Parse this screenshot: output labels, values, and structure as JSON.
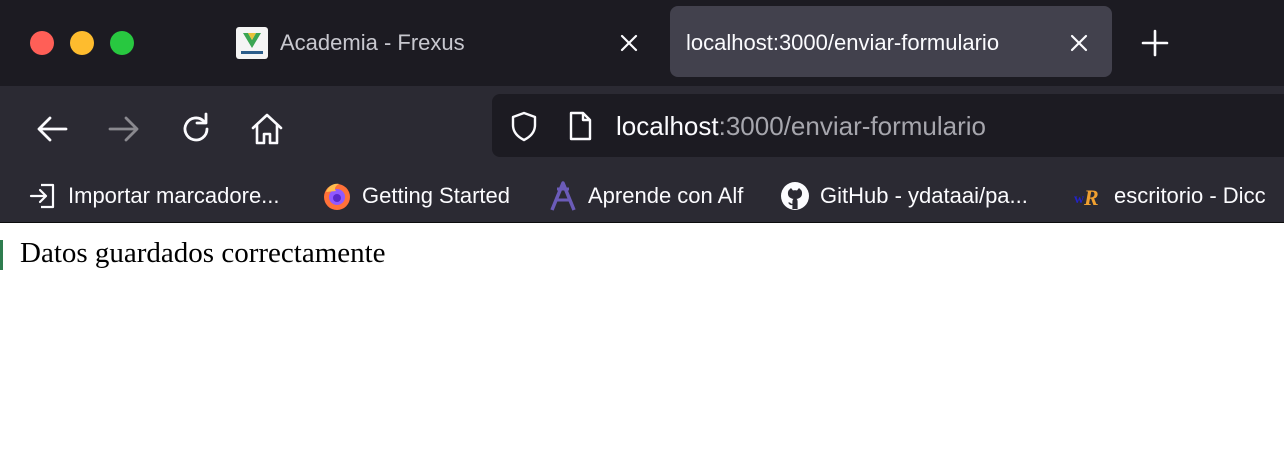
{
  "window": {
    "controls": [
      "close",
      "minimize",
      "zoom"
    ]
  },
  "tabs": [
    {
      "title": "Academia - Frexus",
      "favicon": "frexus-logo-icon",
      "active": false
    },
    {
      "title": "localhost:3000/enviar-formulario",
      "active": true
    }
  ],
  "toolbar": {
    "url_host": "localhost",
    "url_rest": ":3000/enviar-formulario"
  },
  "bookmarks": [
    {
      "label": "Importar marcadore...",
      "icon": "import-icon"
    },
    {
      "label": "Getting Started",
      "icon": "firefox-icon"
    },
    {
      "label": "Aprende con Alf",
      "icon": "alf-logo-icon"
    },
    {
      "label": "GitHub - ydataai/pa...",
      "icon": "github-icon"
    },
    {
      "label": "escritorio - Dicc",
      "icon": "wordreference-icon"
    }
  ],
  "content": {
    "message": "Datos guardados correctamente"
  },
  "colors": {
    "tabbar_bg": "#1c1b22",
    "toolbar_bg": "#2b2a33",
    "active_tab_bg": "#42414d",
    "text": "#fbfbfe",
    "url_dim": "#a6a6ad"
  }
}
